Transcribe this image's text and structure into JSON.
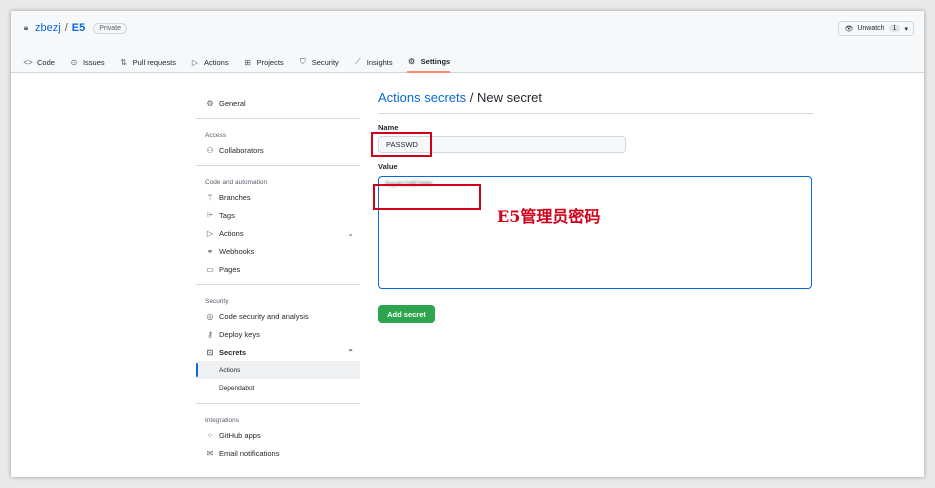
{
  "repo": {
    "owner": "zbezj",
    "separator": "/",
    "name": "E5",
    "visibility": "Private"
  },
  "watch": {
    "label": "Unwatch",
    "count": "1"
  },
  "tabs": [
    {
      "label": "Code",
      "icon": "code-icon"
    },
    {
      "label": "Issues",
      "icon": "issue-icon"
    },
    {
      "label": "Pull requests",
      "icon": "pull-request-icon"
    },
    {
      "label": "Actions",
      "icon": "play-icon"
    },
    {
      "label": "Projects",
      "icon": "table-icon"
    },
    {
      "label": "Security",
      "icon": "shield-icon"
    },
    {
      "label": "Insights",
      "icon": "graph-icon"
    },
    {
      "label": "Settings",
      "icon": "gear-icon"
    }
  ],
  "sidebar": {
    "general": "General",
    "access_heading": "Access",
    "collaborators": "Collaborators",
    "code_heading": "Code and automation",
    "branches": "Branches",
    "tags": "Tags",
    "actions": "Actions",
    "webhooks": "Webhooks",
    "pages": "Pages",
    "security_heading": "Security",
    "code_security": "Code security and analysis",
    "deploy_keys": "Deploy keys",
    "secrets": "Secrets",
    "secrets_actions": "Actions",
    "secrets_dependabot": "Dependabot",
    "integrations_heading": "Integrations",
    "github_apps": "GitHub apps",
    "email_notifications": "Email notifications"
  },
  "main": {
    "breadcrumb_link": "Actions secrets",
    "breadcrumb_rest": " / New secret",
    "name_label": "Name",
    "name_value": "PASSWD",
    "value_label": "Value",
    "value_text": "5op4r!2#$7###",
    "add_button": "Add secret"
  },
  "annotation": "E5管理员密码",
  "colors": {
    "accent": "#0969da",
    "button": "#2da44e",
    "highlight": "#d0021b",
    "tab_underline": "#fd8c73"
  }
}
